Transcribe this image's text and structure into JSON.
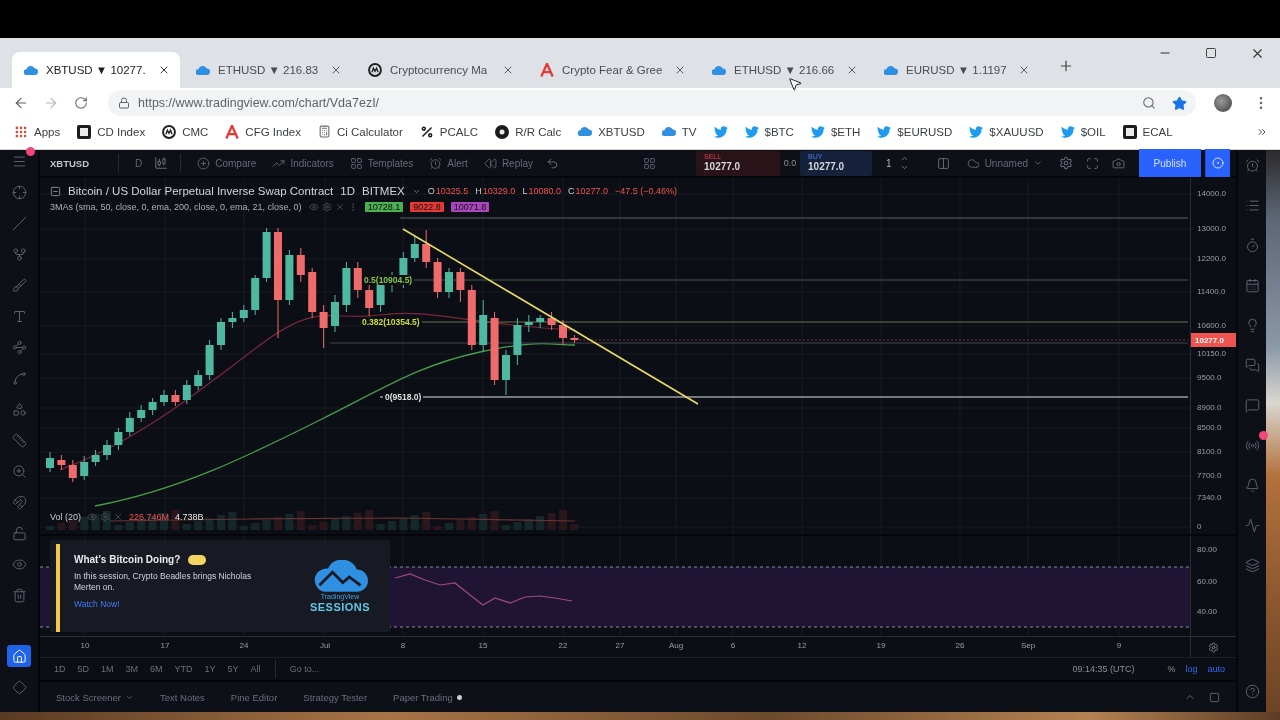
{
  "browser": {
    "tabs": [
      {
        "title": "XBTUSD ▼ 10277.",
        "kind": "tradingview",
        "selected": true
      },
      {
        "title": "ETHUSD ▼ 216.83",
        "kind": "tradingview",
        "selected": false
      },
      {
        "title": "Cryptocurrency Ma",
        "kind": "coinmarketcap",
        "selected": false
      },
      {
        "title": "Crypto Fear & Gree",
        "kind": "fear-greed",
        "selected": false
      },
      {
        "title": "ETHUSD ▼ 216.66",
        "kind": "tradingview",
        "selected": false
      },
      {
        "title": "EURUSD ▼ 1.1197",
        "kind": "tradingview",
        "selected": false
      }
    ],
    "url": "https://www.tradingview.com/chart/Vda7ezI/",
    "bookmarks": [
      {
        "label": "Apps",
        "kind": "apps"
      },
      {
        "label": "CD Index",
        "kind": "dark-square"
      },
      {
        "label": "CMC",
        "kind": "coinmarketcap"
      },
      {
        "label": "CFG Index",
        "kind": "fear-greed"
      },
      {
        "label": "Ci Calculator",
        "kind": "calculator"
      },
      {
        "label": "PCALC",
        "kind": "percent"
      },
      {
        "label": "R/R Calc",
        "kind": "dark-circle"
      },
      {
        "label": "XBTUSD",
        "kind": "tradingview"
      },
      {
        "label": "TV",
        "kind": "tradingview"
      },
      {
        "kind": "twitter"
      },
      {
        "label": "$BTC",
        "kind": "twitter"
      },
      {
        "label": "$ETH",
        "kind": "twitter"
      },
      {
        "label": "$EURUSD",
        "kind": "twitter"
      },
      {
        "label": "$XAUUSD",
        "kind": "twitter"
      },
      {
        "label": "$OIL",
        "kind": "twitter"
      },
      {
        "label": "ECAL",
        "kind": "dark-square"
      }
    ]
  },
  "left_toolbar": {
    "tools": [
      {
        "kind": "menu",
        "selected": false,
        "notified": true
      },
      {
        "kind": "crosshair",
        "selected": false,
        "notified": false
      },
      {
        "kind": "line",
        "selected": false,
        "notified": false
      },
      {
        "kind": "fork",
        "selected": false,
        "notified": false
      },
      {
        "kind": "brush",
        "selected": false,
        "notified": false
      },
      {
        "kind": "text",
        "selected": false,
        "notified": false
      },
      {
        "kind": "nodes",
        "selected": false,
        "notified": false
      },
      {
        "kind": "curve",
        "selected": false,
        "notified": false
      },
      {
        "kind": "shapes",
        "selected": false,
        "notified": false
      },
      {
        "kind": "ruler",
        "selected": false,
        "notified": false
      },
      {
        "kind": "zoom",
        "selected": false,
        "notified": false
      },
      {
        "kind": "magnet",
        "selected": false,
        "notified": false
      },
      {
        "kind": "lock",
        "selected": false,
        "notified": false
      },
      {
        "kind": "eye",
        "selected": false,
        "notified": false
      },
      {
        "kind": "trash",
        "selected": false,
        "notified": false
      }
    ],
    "bottom_tools": [
      {
        "kind": "house",
        "selected": true,
        "notified": false
      },
      {
        "kind": "diamond",
        "selected": false,
        "notified": false
      }
    ]
  },
  "toolbar": {
    "symbol": "XBTUSD",
    "interval": "D",
    "items": [
      {
        "label": "Compare",
        "kind": "compare"
      },
      {
        "label": "Indicators",
        "kind": "indicators"
      },
      {
        "label": "Templates",
        "kind": "templates"
      },
      {
        "label": "Alert",
        "kind": "alert"
      },
      {
        "label": "Replay",
        "kind": "replay"
      }
    ],
    "sell": {
      "label": "SELL",
      "price": "10277.0"
    },
    "spread": "0.0",
    "buy": {
      "label": "BUY",
      "price": "10277.0"
    },
    "quantity": "1",
    "layout_name": "Unnamed",
    "publish": "Publish"
  },
  "legend": {
    "title": "Bitcoin / US Dollar Perpetual Inverse Swap Contract",
    "interval": "1D",
    "exchange": "BITMEX",
    "ohlc": [
      {
        "key": "O",
        "value": "10325.5"
      },
      {
        "key": "H",
        "value": "10329.0"
      },
      {
        "key": "L",
        "value": "10080.0"
      },
      {
        "key": "C",
        "value": "10277.0"
      }
    ],
    "change": "−47.5 (−0.46%)",
    "indicator": {
      "name": "3MAs (sma, 50, close, 0, ema, 200, close, 0, ema, 21, close, 0)",
      "values": [
        {
          "value": "10728.1",
          "color": "#4caf50"
        },
        {
          "value": "9022.8",
          "color": "#e53935"
        },
        {
          "value": "10071.8",
          "color": "#ab47bc"
        }
      ]
    }
  },
  "fib_labels": [
    {
      "text": "0.5(10904.5)",
      "color": "#8bc34a"
    },
    {
      "text": "0.382(10354.5)",
      "color": "#cddc39"
    },
    {
      "text": "0(9518.0)",
      "color": "#e0e0e0"
    }
  ],
  "volume": {
    "label": "Vol (20)",
    "value": "226.746M",
    "average": "4.738B"
  },
  "price_axis": {
    "labels": [
      "14000.0",
      "13000.0",
      "12200.0",
      "11400.0",
      "10600.0",
      "10150.0",
      "9500.0",
      "8900.0",
      "8500.0",
      "8100.0",
      "7700.0",
      "7340.0",
      "0"
    ],
    "last_price": "10277.0"
  },
  "promo": {
    "title": "What's Bitcoin Doing?",
    "text": "In this session, Crypto Beadles brings Nicholas Merten on.",
    "link": "Watch Now!",
    "logo_name": "TradingView",
    "logo_caption": "SESSIONS"
  },
  "rsi_axis": [
    "80.00",
    "60.00",
    "40.00"
  ],
  "time_axis": [
    "10",
    "17",
    "24",
    "Jul",
    "8",
    "15",
    "22",
    "27",
    "Aug",
    "6",
    "12",
    "19",
    "26",
    "Sep",
    "9"
  ],
  "range_bar": {
    "ranges": [
      "1D",
      "5D",
      "1M",
      "3M",
      "6M",
      "YTD",
      "1Y",
      "5Y",
      "All"
    ],
    "goto": "Go to...",
    "clock": "09:14:35 (UTC)",
    "scale_buttons": [
      {
        "label": "%",
        "on": false
      },
      {
        "label": "log",
        "on": true
      },
      {
        "label": "auto",
        "on": true
      }
    ]
  },
  "bottom_tabs": [
    {
      "label": "Stock Screener",
      "kind": "menu"
    },
    {
      "label": "Text Notes",
      "kind": "plain"
    },
    {
      "label": "Pine Editor",
      "kind": "plain"
    },
    {
      "label": "Strategy Tester",
      "kind": "plain"
    },
    {
      "label": "Paper Trading",
      "kind": "status"
    }
  ],
  "right_toolbar": {
    "tools": [
      {
        "kind": "alarm",
        "notified": false
      },
      {
        "kind": "list",
        "notified": false
      },
      {
        "kind": "timer",
        "notified": false
      },
      {
        "kind": "calendar",
        "notified": false
      },
      {
        "kind": "lightbulb",
        "notified": false
      },
      {
        "kind": "chats",
        "notified": false
      },
      {
        "kind": "chat",
        "notified": false
      },
      {
        "kind": "broadcast",
        "notified": true
      },
      {
        "kind": "bell",
        "notified": false
      },
      {
        "kind": "pulse",
        "notified": false
      },
      {
        "kind": "layers",
        "notified": false
      }
    ],
    "bottom_tools": [
      {
        "kind": "help",
        "notified": false
      }
    ]
  }
}
